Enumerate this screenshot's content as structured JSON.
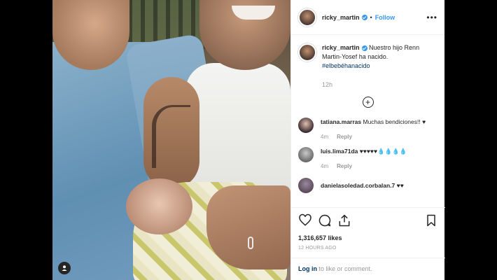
{
  "post": {
    "username": "ricky_martin",
    "follow_label": "Follow",
    "dot": "•",
    "more": "•••",
    "caption": {
      "username": "ricky_martin",
      "text": " Nuestro hijo Renn Martin-Yosef ha nacido.",
      "hashtag": "#elbebéhanacido",
      "time": "12h"
    },
    "load_more": "+",
    "comments": [
      {
        "username": "tatiana.marras",
        "text": " Muchas bendiciones!! ♥",
        "time": "4m",
        "reply": "Reply"
      },
      {
        "username": "luis.lima71da",
        "text": " ♥♥♥♥♥💧💧💧💧",
        "time": "4m",
        "reply": "Reply"
      },
      {
        "username": "danielasoledad.corbalan.7",
        "text": " ♥♥"
      }
    ],
    "likes": "1,316,657 likes",
    "time_ago": "12 HOURS AGO",
    "login": {
      "link": "Log in",
      "rest": " to like or comment."
    }
  },
  "icons": [
    "user-tag-icon",
    "heart-icon",
    "comment-icon",
    "share-icon",
    "bookmark-icon",
    "verified-icon",
    "plus-circle-icon"
  ]
}
